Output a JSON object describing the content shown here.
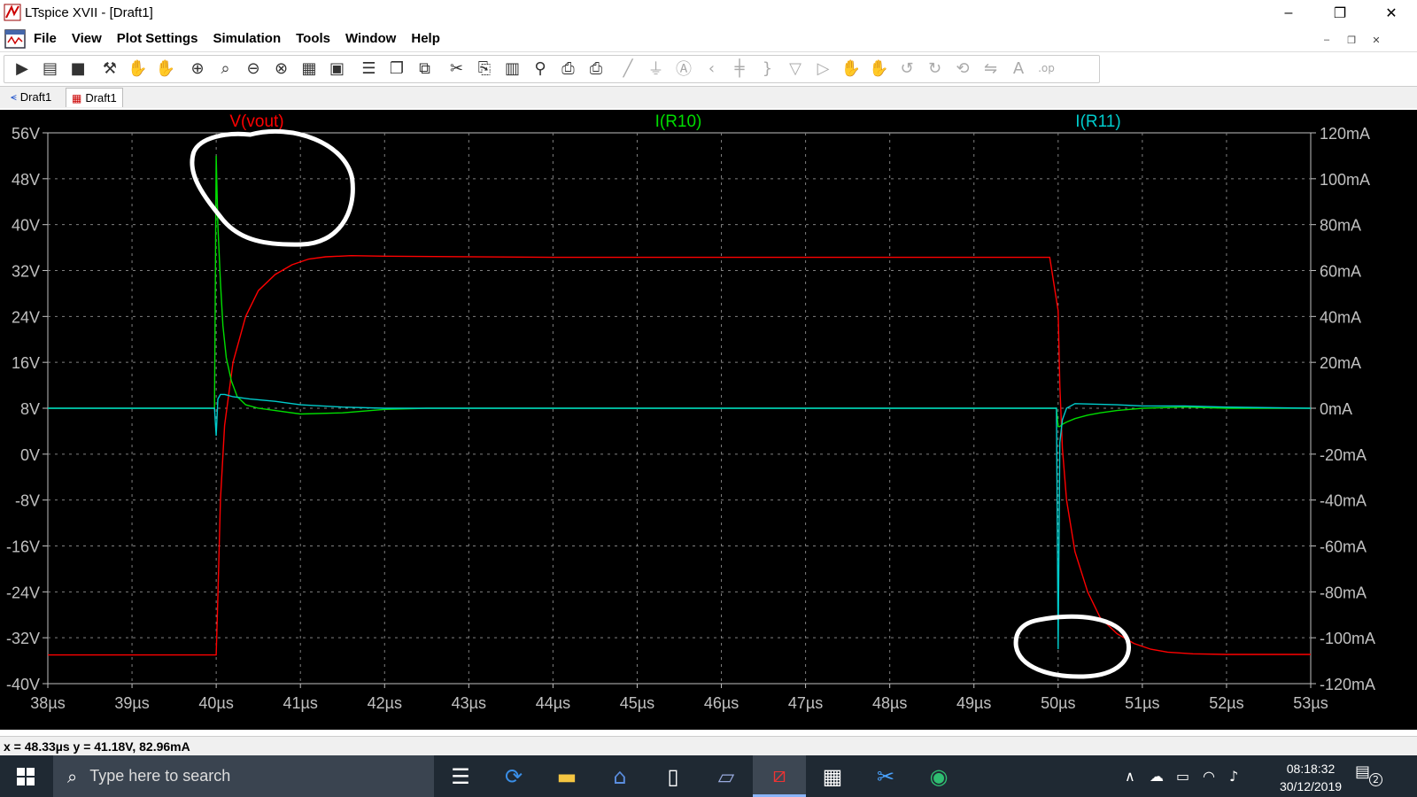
{
  "window": {
    "title": "LTspice XVII - [Draft1]",
    "controls": {
      "minimize": "–",
      "restore": "❐",
      "close": "✕"
    },
    "mdi_controls": {
      "minimize": "–",
      "restore": "❐",
      "close": "✕"
    }
  },
  "menu": {
    "items": [
      "File",
      "View",
      "Plot Settings",
      "Simulation",
      "Tools",
      "Window",
      "Help"
    ]
  },
  "toolbar": {
    "icons": [
      "run-icon",
      "open-icon",
      "save-icon",
      "control-panel-icon",
      "halt-icon",
      "pan-icon",
      "zoom-in-icon",
      "zoom-area-icon",
      "zoom-out-icon",
      "zoom-cancel-icon",
      "autorange-icon",
      "zoom-fit-icon",
      "tile-horizontal-icon",
      "cascade-icon",
      "close-window-icon",
      "cut-icon",
      "copy-icon",
      "paste-icon",
      "find-icon",
      "print-icon",
      "print-setup-icon",
      "wire-icon",
      "ground-icon",
      "label-icon",
      "resistor-icon",
      "capacitor-icon",
      "inductor-icon",
      "diode-icon",
      "component-icon",
      "move-icon",
      "drag-icon",
      "undo-icon",
      "redo-icon",
      "rotate-icon",
      "mirror-icon",
      "text-icon",
      "spice-directive-icon"
    ]
  },
  "tabs": [
    {
      "label": "Draft1",
      "icon": "schematic-icon",
      "active": false
    },
    {
      "label": "Draft1",
      "icon": "waveform-icon",
      "active": true
    }
  ],
  "chart_data": {
    "type": "line",
    "title": "",
    "xlabel": "",
    "ylabel_left": "",
    "ylabel_right": "",
    "xlim": [
      38,
      53
    ],
    "x_unit": "µs",
    "ylim_left": [
      -40,
      56
    ],
    "ylim_right": [
      -120,
      120
    ],
    "grid": true,
    "x_ticks": [
      "38µs",
      "39µs",
      "40µs",
      "41µs",
      "42µs",
      "43µs",
      "44µs",
      "45µs",
      "46µs",
      "47µs",
      "48µs",
      "49µs",
      "50µs",
      "51µs",
      "52µs",
      "53µs"
    ],
    "y_left_ticks": [
      "56V",
      "48V",
      "40V",
      "32V",
      "24V",
      "16V",
      "8V",
      "0V",
      "-8V",
      "-16V",
      "-24V",
      "-32V",
      "-40V"
    ],
    "y_right_ticks": [
      "120mA",
      "100mA",
      "80mA",
      "60mA",
      "40mA",
      "20mA",
      "0mA",
      "-20mA",
      "-40mA",
      "-60mA",
      "-80mA",
      "-100mA",
      "-120mA"
    ],
    "series": [
      {
        "name": "V(vout)",
        "axis": "left",
        "color": "#ff0000",
        "x": [
          38,
          40.0,
          40.02,
          40.05,
          40.1,
          40.2,
          40.35,
          40.5,
          40.7,
          40.9,
          41.1,
          41.3,
          41.6,
          42,
          44,
          46,
          48,
          49.9,
          50.0,
          50.02,
          50.05,
          50.1,
          50.2,
          50.35,
          50.5,
          50.7,
          50.9,
          51.1,
          51.3,
          51.6,
          52,
          53
        ],
        "y": [
          -35,
          -35,
          -25,
          -8,
          5,
          16,
          24,
          28.5,
          31.3,
          33,
          34,
          34.4,
          34.6,
          34.5,
          34.3,
          34.3,
          34.3,
          34.3,
          25,
          12,
          1,
          -8,
          -17,
          -24,
          -28.5,
          -31.3,
          -33,
          -34,
          -34.5,
          -34.8,
          -34.9,
          -34.9
        ]
      },
      {
        "name": "I(R10)",
        "axis": "right",
        "color": "#00dd00",
        "x": [
          38,
          39.98,
          40.0,
          40.02,
          40.05,
          40.08,
          40.12,
          40.18,
          40.25,
          40.35,
          40.5,
          40.7,
          41.0,
          41.5,
          42.0,
          42.5,
          44,
          46,
          48,
          49.98,
          50.0,
          50.02,
          50.05,
          50.1,
          50.2,
          50.35,
          50.5,
          50.7,
          51.0,
          51.5,
          52,
          53
        ],
        "y": [
          0,
          0,
          110,
          80,
          55,
          36,
          22,
          12,
          5,
          1.5,
          0,
          -1,
          -2.5,
          -2,
          -0.5,
          0,
          0,
          0,
          0,
          0,
          -8,
          -8,
          -7,
          -6,
          -4.5,
          -3,
          -2,
          -1,
          0,
          0.5,
          0,
          0
        ]
      },
      {
        "name": "I(R11)",
        "axis": "right",
        "color": "#00cccc",
        "x": [
          38,
          39.98,
          40.0,
          40.02,
          40.05,
          40.1,
          40.2,
          40.4,
          40.7,
          41.0,
          41.5,
          42.0,
          44,
          46,
          48,
          49.98,
          50.0,
          50.02,
          50.05,
          50.1,
          50.2,
          50.4,
          50.7,
          51.0,
          51.5,
          52,
          53
        ],
        "y": [
          0,
          0,
          -12,
          4,
          6,
          6,
          5,
          4,
          3,
          1.5,
          0.5,
          0,
          0,
          0,
          0,
          0,
          -105,
          -15,
          -5,
          0,
          2,
          1.8,
          1.5,
          1,
          1,
          0.5,
          0
        ]
      }
    ],
    "annotations": [
      {
        "shape": "freehand-ellipse",
        "color": "#ffffff",
        "around": {
          "x": 40.7,
          "y_right": 98
        }
      },
      {
        "shape": "freehand-ellipse",
        "color": "#ffffff",
        "around": {
          "x": 50.3,
          "y_right": -103
        }
      }
    ]
  },
  "status": {
    "cursor_readout": "x = 48.33µs    y = 41.18V, 82.96mA"
  },
  "taskbar": {
    "search_placeholder": "Type here to search",
    "apps": [
      "task-view-icon",
      "refresh-app-icon",
      "file-explorer-icon",
      "bank-app-icon",
      "document-icon",
      "notepad-icon",
      "ltspice-icon",
      "calculator-icon",
      "snipping-tool-icon",
      "edge-dev-icon"
    ],
    "tray_icons": [
      "chevron-up-icon",
      "cloud-icon",
      "battery-icon",
      "wifi-icon",
      "volume-icon"
    ],
    "time": "08:18:32",
    "date": "30/12/2019",
    "notification_count": "2"
  }
}
